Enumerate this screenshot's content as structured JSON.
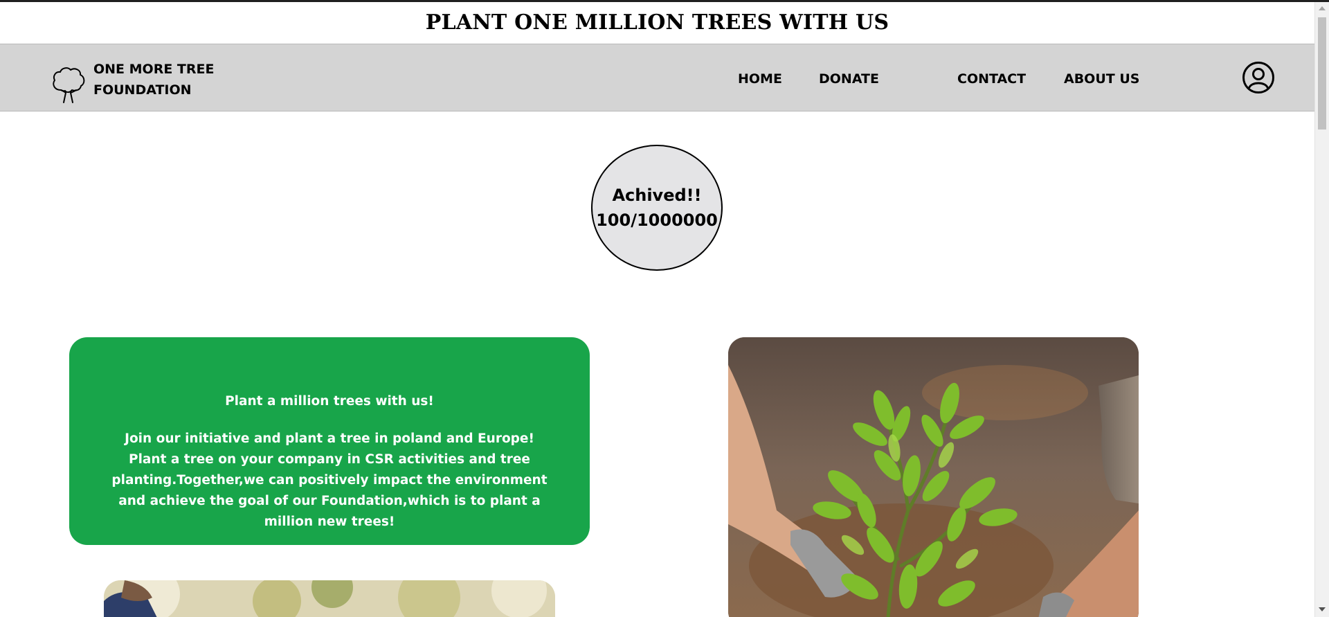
{
  "banner": {
    "title": "PLANT ONE MILLION TREES WITH US"
  },
  "header": {
    "logo_icon": "tree-icon",
    "logo_line1": "ONE MORE TREE",
    "logo_line2": "FOUNDATION",
    "nav": {
      "home": "HOME",
      "donate": "DONATE",
      "contact": "CONTACT",
      "about": "ABOUT US"
    },
    "user_icon": "user-account-icon"
  },
  "counter": {
    "label": "Achived!!",
    "value": "100/1000000"
  },
  "intro": {
    "headline": "Plant a million trees with us!",
    "body": "Join our initiative and plant a tree in poland and Europe! Plant a tree on your company in CSR activities and tree planting.Together,we can positively impact the environment and achieve the goal of our Foundation,which is to plant a million new trees!"
  },
  "colors": {
    "banner_bg": "#ffffff",
    "nav_bg": "#d4d4d4",
    "counter_bg": "#e4e4e6",
    "card_green": "#18a54a"
  }
}
